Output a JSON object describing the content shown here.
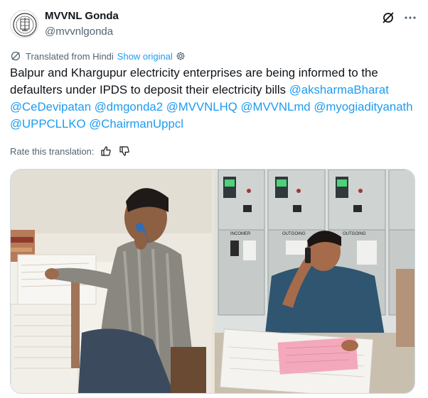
{
  "account": {
    "name": "MVVNL Gonda",
    "handle": "@mvvnlgonda",
    "avatar_icon": "emblem-logo-icon"
  },
  "header_actions": {
    "grok_icon": "grok-icon",
    "more_icon": "more-options-icon"
  },
  "translation": {
    "label": "Translated from Hindi",
    "show_original": "Show original",
    "settings_icon": "gear-icon",
    "rate_label": "Rate this translation:",
    "thumbs_up_icon": "thumbs-up-icon",
    "thumbs_down_icon": "thumbs-down-icon"
  },
  "tweet": {
    "text": "Balpur and Khargupur electricity enterprises are being informed to the defaulters under IPDS to deposit their electricity bills",
    "mentions": [
      "@aksharmaBharat",
      "@CeDevipatan",
      "@dmgonda2",
      "@MVVNLHQ",
      "@MVVNLmd",
      "@myogiadityanath",
      "@UPPCLLKO",
      "@ChairmanUppcl"
    ]
  },
  "media": {
    "left_photo": "man-on-phone-at-desk-photo",
    "right_photo": "man-on-phone-at-switchgear-panel-photo",
    "panel_labels": [
      "INCOMER",
      "OUTGOING",
      "OUTGOING"
    ]
  },
  "colors": {
    "link": "#1d9bf0",
    "text": "#0f1419",
    "muted": "#536471"
  }
}
